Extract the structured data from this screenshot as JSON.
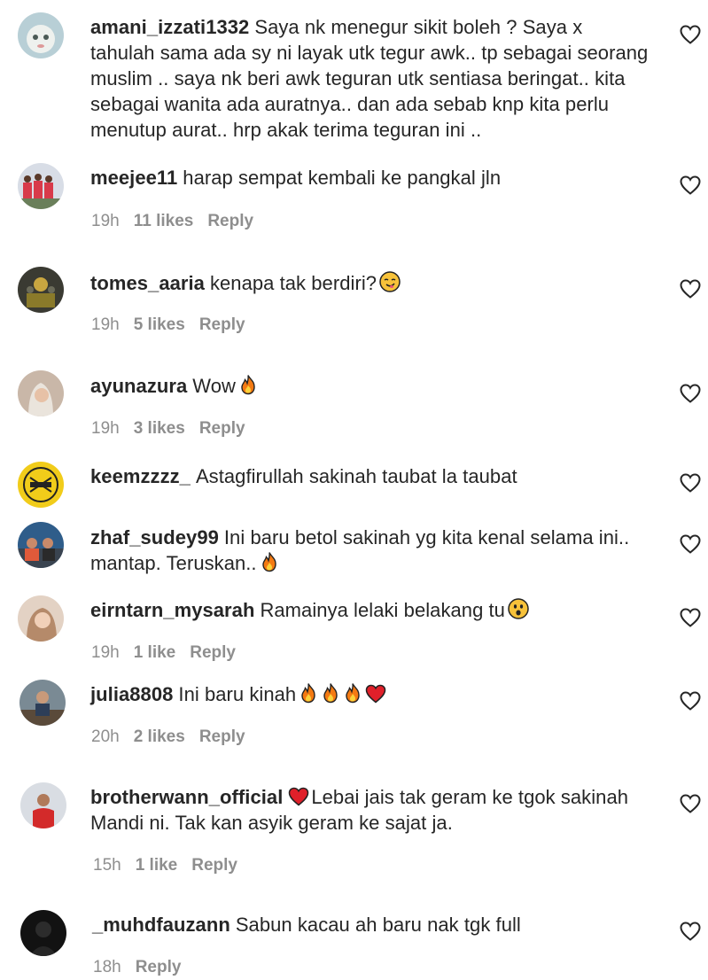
{
  "comments": [
    {
      "username": "amani_izzati1332",
      "text": "Saya nk menegur sikit boleh ? Saya x tahulah sama ada sy ni layak utk tegur awk.. tp sebagai seorang muslim .. saya nk beri awk teguran utk sentiasa beringat.. kita sebagai wanita ada auratnya.. dan ada sebab knp kita perlu menutup aurat.. hrp akak terima teguran ini ..",
      "time": "",
      "likes": "",
      "reply": "",
      "avatar_color": "#b8cfd6"
    },
    {
      "username": "meejee11",
      "text": "harap sempat kembali ke pangkal jln",
      "time": "19h",
      "likes": "11 likes",
      "reply": "Reply",
      "avatar_color": "#d8dde6"
    },
    {
      "username": "tomes_aaria",
      "text": "kenapa tak berdiri?",
      "emoji": [
        "smirk-emoji"
      ],
      "time": "19h",
      "likes": "5 likes",
      "reply": "Reply",
      "avatar_color": "#3a3a32"
    },
    {
      "username": "ayunazura",
      "text": "Wow",
      "emoji": [
        "fire-emoji"
      ],
      "time": "19h",
      "likes": "3 likes",
      "reply": "Reply",
      "avatar_color": "#c9b7a8"
    },
    {
      "username": "keemzzzz_",
      "text": "Astagfirullah sakinah taubat la taubat",
      "time": "",
      "likes": "",
      "reply": "",
      "avatar_color": "#f1cc1a"
    },
    {
      "username": "zhaf_sudey99",
      "text": "Ini baru betol sakinah yg kita kenal selama ini.. mantap. Teruskan..",
      "emoji": [
        "fire-emoji"
      ],
      "time": "",
      "likes": "",
      "reply": "",
      "avatar_color": "#2f5d8a"
    },
    {
      "username": "eirntarn_mysarah",
      "text": "Ramainya lelaki belakang tu",
      "emoji": [
        "surprised-emoji"
      ],
      "time": "19h",
      "likes": "1 like",
      "reply": "Reply",
      "avatar_color": "#e3d2c4"
    },
    {
      "username": "julia8808",
      "text": "Ini baru kinah",
      "emoji": [
        "fire-emoji",
        "fire-emoji",
        "fire-emoji",
        "heart-emoji"
      ],
      "time": "20h",
      "likes": "2 likes",
      "reply": "Reply",
      "avatar_color": "#7a8a94"
    },
    {
      "username": "brotherwann_official",
      "text": "Lebai jais tak geram ke tgok sakinah Mandi ni. Tak kan asyik geram ke sajat ja.",
      "lead_emoji": "heart-emoji",
      "time": "15h",
      "likes": "1 like",
      "reply": "Reply",
      "avatar_color": "#d9dde3"
    },
    {
      "username": "_muhdfauzann",
      "text": "Sabun kacau ah baru nak tgk full",
      "time": "18h",
      "likes": "",
      "reply": "Reply",
      "avatar_color": "#121212"
    }
  ],
  "like_icon": "heart-outline-icon"
}
